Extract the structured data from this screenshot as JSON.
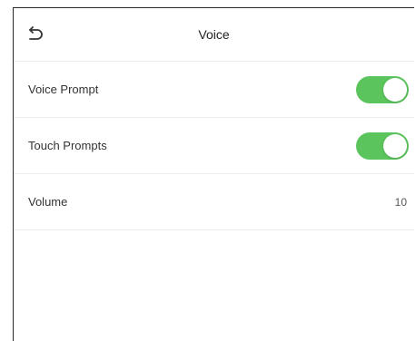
{
  "header": {
    "title": "Voice",
    "back_icon": "back-arrow-icon"
  },
  "settings": [
    {
      "label": "Voice Prompt",
      "type": "toggle",
      "on": true
    },
    {
      "label": "Touch Prompts",
      "type": "toggle",
      "on": true
    },
    {
      "label": "Volume",
      "type": "value",
      "value": "10"
    }
  ],
  "colors": {
    "toggle_on": "#5cc45c",
    "divider": "#ececec"
  }
}
